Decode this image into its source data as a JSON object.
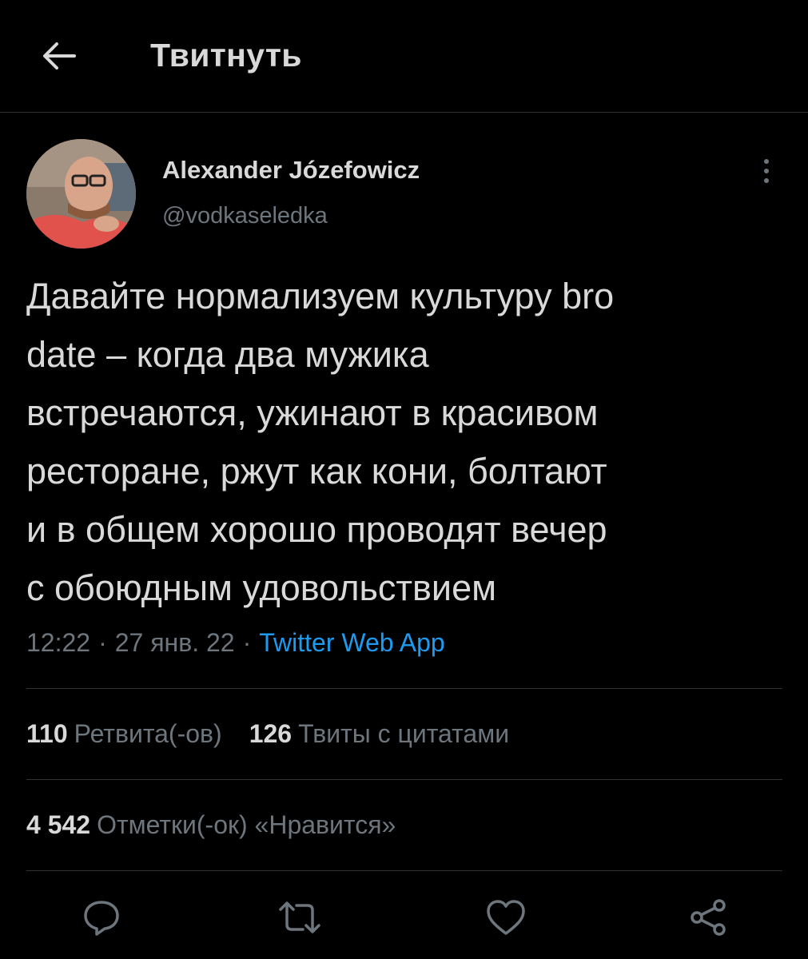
{
  "header": {
    "title": "Твитнуть"
  },
  "author": {
    "name": "Alexander Józefowicz",
    "handle": "@vodkaseledka"
  },
  "tweet": {
    "lines": [
      "Давайте нормализуем культуру bro",
      "date – когда два мужика",
      "встречаются, ужинают в красивом",
      "ресторане, ржут как кони, болтают",
      "и в общем хорошо проводят вечер",
      "с обоюдным удовольствием"
    ],
    "time": "12:22",
    "date": "27 янв. 22",
    "separator": "·",
    "source": "Twitter Web App"
  },
  "stats": {
    "retweets_count": "110",
    "retweets_label": "Ретвита(-ов)",
    "quotes_count": "126",
    "quotes_label": "Твиты с цитатами",
    "likes_count": "4 542",
    "likes_label": "Отметки(-ок) «Нравится»"
  },
  "colors": {
    "background": "#000000",
    "text": "#d9d9d9",
    "secondary": "#6e767d",
    "accent": "#1d9bf0",
    "divider": "#2f3336"
  },
  "icons": [
    "back-arrow-icon",
    "more-vertical-icon",
    "reply-icon",
    "retweet-icon",
    "like-icon",
    "share-icon"
  ]
}
